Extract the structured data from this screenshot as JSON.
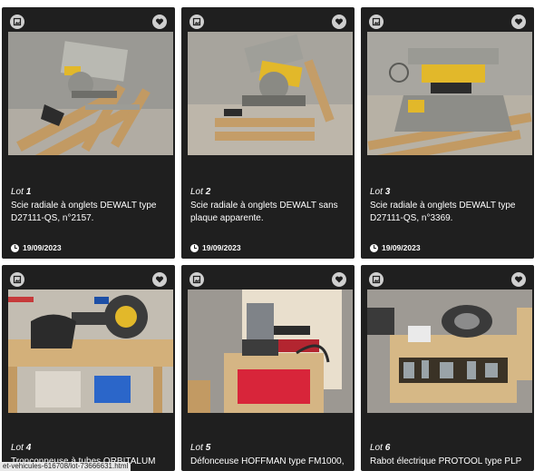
{
  "lots": [
    {
      "lot_label": "Lot",
      "lot_number": "1",
      "description": "Scie radiale à onglets DEWALT type D27111-QS, n°2157.",
      "date": "19/09/2023"
    },
    {
      "lot_label": "Lot",
      "lot_number": "2",
      "description": "Scie radiale à onglets DEWALT sans plaque apparente.",
      "date": "19/09/2023"
    },
    {
      "lot_label": "Lot",
      "lot_number": "3",
      "description": "Scie radiale à onglets DEWALT type D27111-QS, n°3369.",
      "date": "19/09/2023"
    },
    {
      "lot_label": "Lot",
      "lot_number": "4",
      "description": "Tronçonneuse à tubes ORBITALUM",
      "date": ""
    },
    {
      "lot_label": "Lot",
      "lot_number": "5",
      "description": "Défonceuse HOFFMAN type FM1000,",
      "date": ""
    },
    {
      "lot_label": "Lot",
      "lot_number": "6",
      "description": "Rabot électrique PROTOOL type PLP",
      "date": ""
    }
  ],
  "status_url": "et-vehicules-616708/lot-73666631.html",
  "icons": {
    "gallery": "gallery-icon",
    "favorite": "heart-icon",
    "date": "clock-icon"
  },
  "colors": {
    "card_bg": "#1f1f1f",
    "icon_bg": "#cfcfcf",
    "text": "#ffffff"
  }
}
